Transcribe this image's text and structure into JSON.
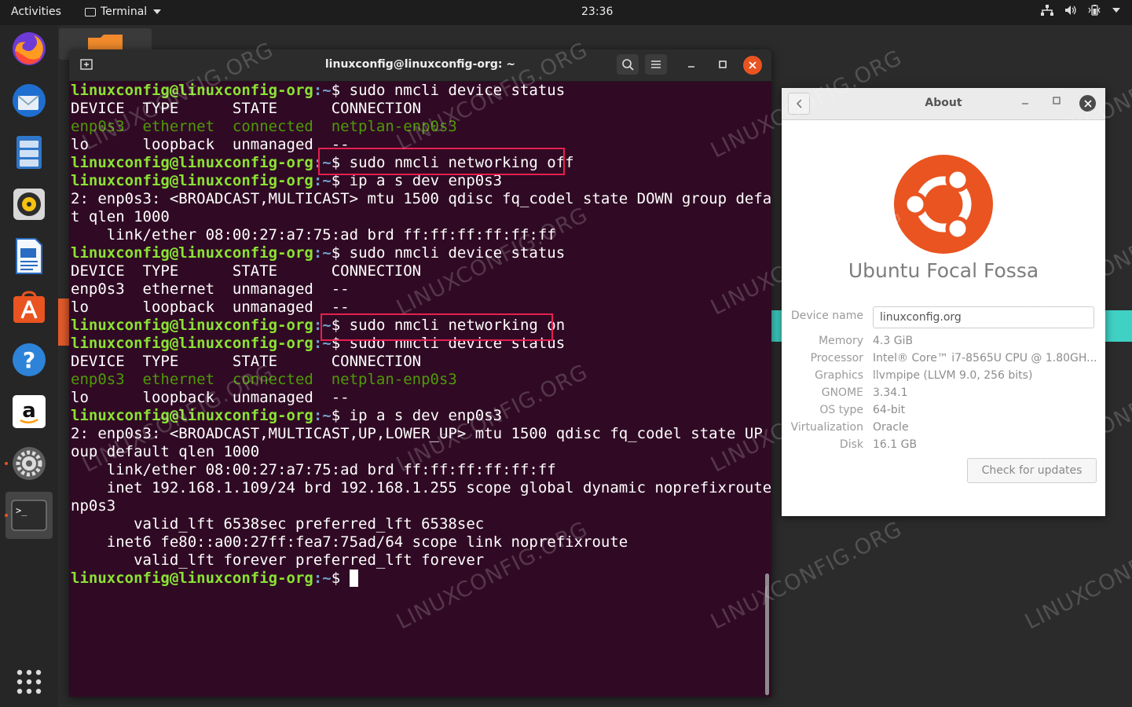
{
  "topbar": {
    "activities": "Activities",
    "app_name": "Terminal",
    "clock": "23:36"
  },
  "dock": {
    "items": [
      "firefox-icon",
      "thunderbird-icon",
      "files-icon",
      "rhythmbox-icon",
      "libreoffice-writer-icon",
      "software-icon",
      "help-icon",
      "amazon-icon",
      "settings-icon",
      "terminal-icon"
    ],
    "show_apps": "grid-icon"
  },
  "terminal": {
    "title": "linuxconfig@linuxconfig-org: ~",
    "prompt_user": "linuxconfig@linuxconfig-org",
    "prompt_path": ":~",
    "prompt_sign": "$ ",
    "lines": [
      {
        "kind": "cmd",
        "cmd": "sudo nmcli device status"
      },
      {
        "kind": "out",
        "text": "DEVICE  TYPE      STATE      CONNECTION"
      },
      {
        "kind": "grn",
        "text": "enp0s3  ethernet  connected  netplan-enp0s3"
      },
      {
        "kind": "out",
        "text": "lo      loopback  unmanaged  --"
      },
      {
        "kind": "cmd",
        "cmd": "sudo nmcli networking off"
      },
      {
        "kind": "cmd",
        "cmd": "ip a s dev enp0s3"
      },
      {
        "kind": "out",
        "text": "2: enp0s3: <BROADCAST,MULTICAST> mtu 1500 qdisc fq_codel state DOWN group defaul"
      },
      {
        "kind": "out",
        "text": "t qlen 1000"
      },
      {
        "kind": "out",
        "text": "    link/ether 08:00:27:a7:75:ad brd ff:ff:ff:ff:ff:ff"
      },
      {
        "kind": "cmd",
        "cmd": "sudo nmcli device status"
      },
      {
        "kind": "out",
        "text": "DEVICE  TYPE      STATE      CONNECTION"
      },
      {
        "kind": "out",
        "text": "enp0s3  ethernet  unmanaged  --"
      },
      {
        "kind": "out",
        "text": "lo      loopback  unmanaged  --"
      },
      {
        "kind": "cmd",
        "cmd": "sudo nmcli networking on"
      },
      {
        "kind": "cmd",
        "cmd": "sudo nmcli device status"
      },
      {
        "kind": "out",
        "text": "DEVICE  TYPE      STATE      CONNECTION"
      },
      {
        "kind": "grn",
        "text": "enp0s3  ethernet  connected  netplan-enp0s3"
      },
      {
        "kind": "out",
        "text": "lo      loopback  unmanaged  --"
      },
      {
        "kind": "cmd",
        "cmd": "ip a s dev enp0s3"
      },
      {
        "kind": "out",
        "text": "2: enp0s3: <BROADCAST,MULTICAST,UP,LOWER_UP> mtu 1500 qdisc fq_codel state UP gr"
      },
      {
        "kind": "out",
        "text": "oup default qlen 1000"
      },
      {
        "kind": "out",
        "text": "    link/ether 08:00:27:a7:75:ad brd ff:ff:ff:ff:ff:ff"
      },
      {
        "kind": "out",
        "text": "    inet 192.168.1.109/24 brd 192.168.1.255 scope global dynamic noprefixroute e"
      },
      {
        "kind": "out",
        "text": "np0s3"
      },
      {
        "kind": "out",
        "text": "       valid_lft 6538sec preferred_lft 6538sec"
      },
      {
        "kind": "out",
        "text": "    inet6 fe80::a00:27ff:fea7:75ad/64 scope link noprefixroute"
      },
      {
        "kind": "out",
        "text": "       valid_lft forever preferred_lft forever"
      },
      {
        "kind": "prompt"
      }
    ]
  },
  "about": {
    "title": "About",
    "os_name": "Ubuntu Focal Fossa",
    "device_name_label": "Device name",
    "device_name_value": "linuxconfig.org",
    "rows": [
      {
        "label": "Memory",
        "value": "4.3 GiB"
      },
      {
        "label": "Processor",
        "value": "Intel® Core™ i7-8565U CPU @ 1.80GH..."
      },
      {
        "label": "Graphics",
        "value": "llvmpipe (LLVM 9.0, 256 bits)"
      },
      {
        "label": "GNOME",
        "value": "3.34.1"
      },
      {
        "label": "OS type",
        "value": "64-bit"
      },
      {
        "label": "Virtualization",
        "value": "Oracle"
      },
      {
        "label": "Disk",
        "value": "16.1 GB"
      }
    ],
    "check_updates": "Check for updates"
  },
  "watermark": "LINUXCONFIG.ORG",
  "colors": {
    "terminal_bg": "#300a24",
    "prompt_user": "#8ae234",
    "prompt_path": "#729fcf",
    "highlight": "#e5204f",
    "ubuntu_orange": "#e95420"
  }
}
